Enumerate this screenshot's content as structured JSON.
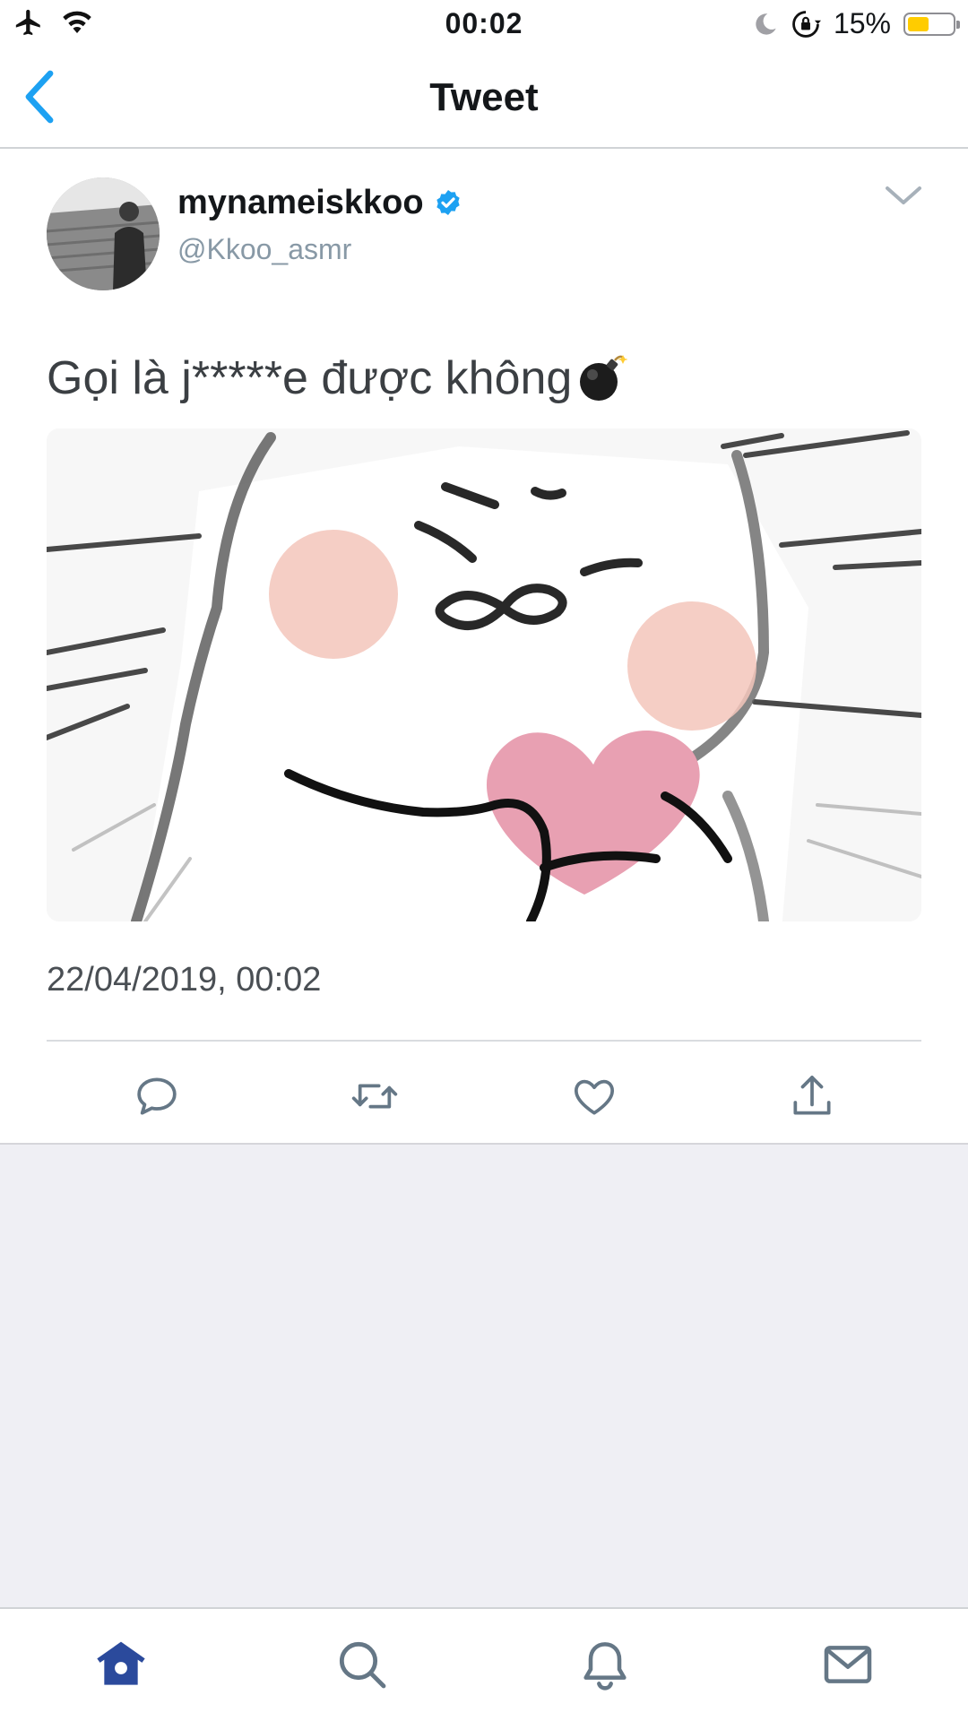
{
  "status_bar": {
    "time": "00:02",
    "battery_percent": "15%",
    "battery_level": 0.15,
    "icons": [
      "airplane-icon",
      "wifi-icon",
      "moon-icon",
      "orientation-lock-icon",
      "battery-icon"
    ]
  },
  "nav": {
    "title": "Tweet",
    "back_icon": "chevron-left-icon"
  },
  "tweet": {
    "display_name": "mynameiskkoo",
    "handle": "@Kkoo_asmr",
    "verified": true,
    "text": "Gọi là j*****e được không",
    "emoji": "bomb",
    "timestamp": "22/04/2019, 00:02",
    "actions": [
      "reply-icon",
      "retweet-icon",
      "like-icon",
      "share-icon"
    ]
  },
  "tab_bar": {
    "tabs": [
      "home-icon",
      "search-icon",
      "notifications-icon",
      "messages-icon"
    ],
    "active": "home-icon"
  },
  "colors": {
    "accent": "#1da1f2",
    "tab_active": "#2b4a9c",
    "icon_gray": "#657786"
  }
}
